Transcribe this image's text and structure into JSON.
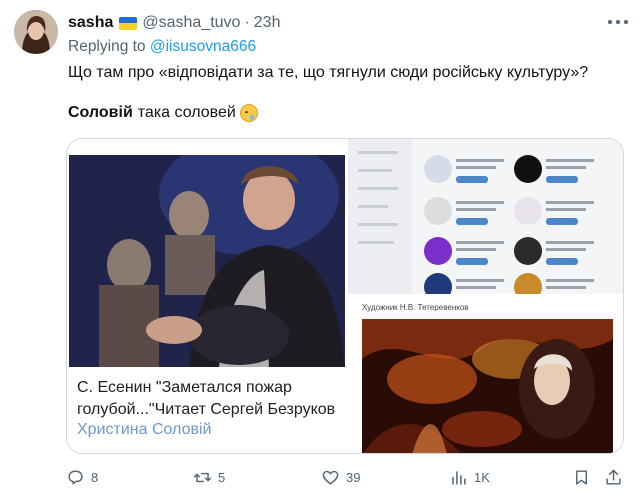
{
  "tweet": {
    "author_name": "sasha",
    "handle": "@sasha_tuvo",
    "separator": "·",
    "time": "23h",
    "reply_prefix": "Replying to ",
    "reply_to": "@iisusovna666",
    "text_line1": "Що там про «відповідати за те, що тягнули сюди російську культуру»?",
    "text_bold": "Соловій",
    "text_rest": "така соловей",
    "icons": {
      "avatar": "avatar",
      "flag": "ukraine-flag",
      "more": "more-dots-icon",
      "emoji": "crying-face-emoji"
    }
  },
  "media": {
    "video_card_title": "С. Есенин \"Заметался пожар голубой...\"Читает Сергей Безруков",
    "video_card_author": "Христина Соловій",
    "painting_caption": "Художник Н.В. Тетеревенков"
  },
  "actions": {
    "replies": "8",
    "reposts": "5",
    "likes": "39",
    "views": "1K"
  },
  "colors": {
    "accent": "#1d9bf0",
    "muted": "#536471",
    "text": "#0f1419",
    "border": "#cfd9de"
  }
}
